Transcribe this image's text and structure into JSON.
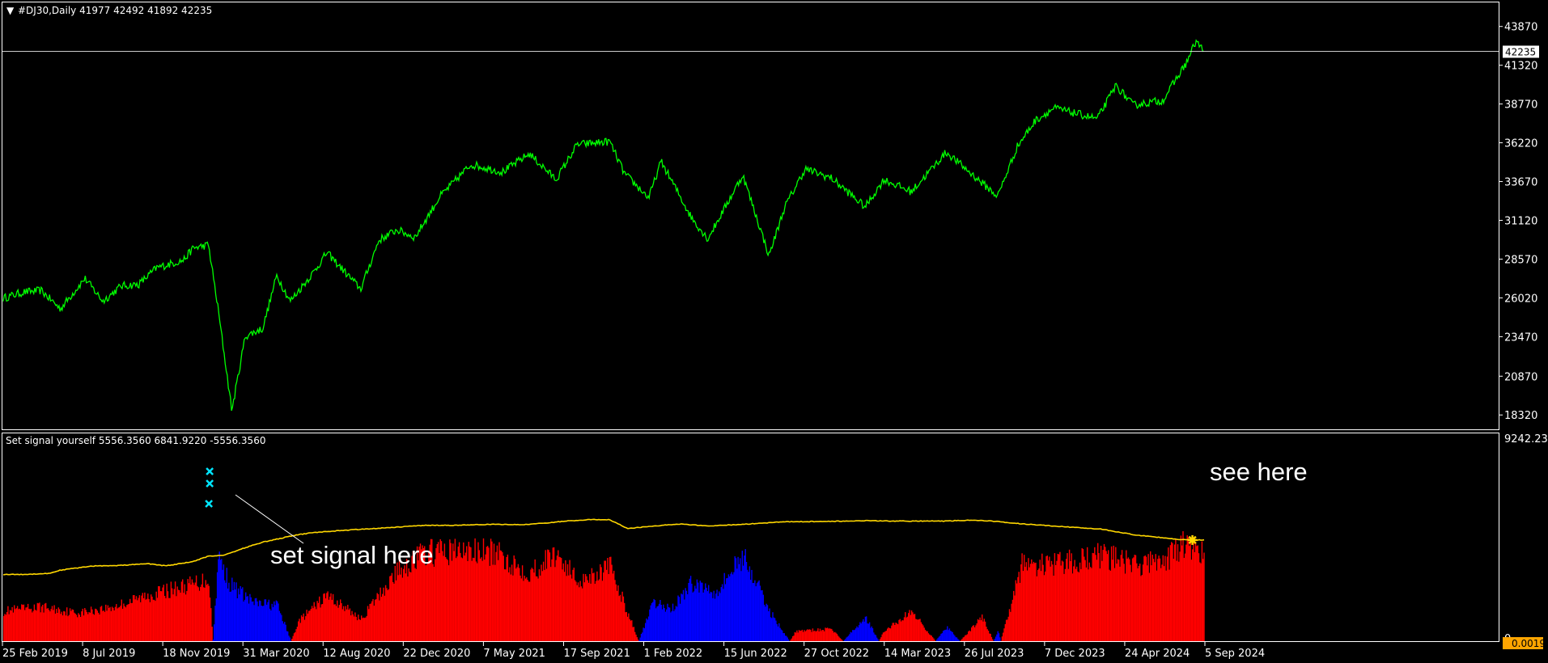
{
  "colors": {
    "background": "#000000",
    "grid_border": "#ffffff",
    "price_line": "#00ff00",
    "ma_line": "#ffd700",
    "hist_positive": "#ff0000",
    "hist_negative": "#0000ff",
    "signal_marker": "#00e5ff",
    "label_box": "#ffa500"
  },
  "main_panel": {
    "symbol_arrow": "▼",
    "title": "#DJ30,Daily  41977 42492 41892 42235",
    "current_price": "42235",
    "y_ticks": [
      "43870",
      "41320",
      "38770",
      "36220",
      "33670",
      "31120",
      "28570",
      "26020",
      "23470",
      "20870",
      "18320"
    ]
  },
  "sub_panel": {
    "title": "Set signal yourself 5556.3560 6841.9220 -5556.3560",
    "y_top": "9242.230",
    "y_zero": "0",
    "y_bottom_tag": "0.0019",
    "annotation_left": "set signal here",
    "annotation_right": "see here"
  },
  "x_ticks": [
    "25 Feb 2019",
    "8 Jul 2019",
    "18 Nov 2019",
    "31 Mar 2020",
    "12 Aug 2020",
    "22 Dec 2020",
    "7 May 2021",
    "17 Sep 2021",
    "1 Feb 2022",
    "15 Jun 2022",
    "27 Oct 2022",
    "14 Mar 2023",
    "26 Jul 2023",
    "7 Dec 2023",
    "24 Apr 2024",
    "5 Sep 2024"
  ],
  "chart_data": [
    {
      "type": "line",
      "title": "#DJ30,Daily  41977 42492 41892 42235",
      "x_range": [
        "2019-02-25",
        "2024-10-15"
      ],
      "ylim": [
        17800,
        44600
      ],
      "y_ticks": [
        43870,
        41320,
        38770,
        36220,
        33670,
        31120,
        28570,
        26020,
        23470,
        20870,
        18320
      ],
      "current_price": 42235,
      "series": [
        {
          "x": [
            "2019-02-25",
            "2019-04-01",
            "2019-05-01",
            "2019-06-03",
            "2019-07-15",
            "2019-08-15",
            "2019-09-15",
            "2019-10-15",
            "2019-11-15",
            "2019-12-31",
            "2020-01-17",
            "2020-02-12",
            "2020-02-28",
            "2020-03-23",
            "2020-04-15",
            "2020-05-15",
            "2020-06-08",
            "2020-07-01",
            "2020-08-12",
            "2020-09-02",
            "2020-10-30",
            "2020-11-30",
            "2020-12-31",
            "2021-01-31",
            "2021-03-15",
            "2021-05-07",
            "2021-06-30",
            "2021-08-15",
            "2021-09-30",
            "2021-11-05",
            "2021-12-31",
            "2022-01-25",
            "2022-03-08",
            "2022-03-29",
            "2022-05-20",
            "2022-06-17",
            "2022-08-16",
            "2022-09-30",
            "2022-10-27",
            "2022-12-01",
            "2023-01-15",
            "2023-03-14",
            "2023-04-15",
            "2023-06-01",
            "2023-07-31",
            "2023-10-27",
            "2023-11-30",
            "2023-12-31",
            "2024-02-01",
            "2024-04-15",
            "2024-05-17",
            "2024-06-15",
            "2024-08-05",
            "2024-09-15",
            "2024-10-01",
            "2024-10-15"
          ],
          "y": [
            26000,
            26400,
            26500,
            25300,
            27300,
            25800,
            26800,
            26900,
            28000,
            28500,
            29300,
            29500,
            25400,
            18600,
            23500,
            24000,
            27500,
            25800,
            27800,
            29000,
            26600,
            29800,
            30500,
            30000,
            32700,
            34800,
            34300,
            35500,
            33800,
            36100,
            36300,
            34200,
            32600,
            35000,
            31300,
            29900,
            34100,
            28800,
            32000,
            34500,
            33900,
            32000,
            33800,
            33000,
            35600,
            32700,
            36000,
            37700,
            38500,
            37800,
            40000,
            38700,
            39000,
            41500,
            42900,
            42235
          ]
        }
      ]
    },
    {
      "type": "bar",
      "title": "Set signal yourself 5556.3560 6841.9220 -5556.3560",
      "x_range": [
        "2019-02-25",
        "2024-10-15"
      ],
      "ylim": [
        0,
        9242.23
      ],
      "histogram_positive_color": "red",
      "histogram_negative_color": "blue",
      "series": [
        {
          "type": "area",
          "x": [
            "2019-02-25",
            "2019-04-01",
            "2019-05-15",
            "2019-06-03",
            "2019-07-01",
            "2019-08-01",
            "2019-09-01",
            "2019-10-01",
            "2019-11-01",
            "2019-12-01",
            "2020-01-17",
            "2020-02-12",
            "2020-03-10",
            "2020-04-10",
            "2020-05-15",
            "2020-06-15",
            "2020-07-15",
            "2020-08-12",
            "2020-09-30",
            "2020-10-30",
            "2020-11-30",
            "2020-12-31",
            "2021-02-15",
            "2021-04-01",
            "2021-05-07",
            "2021-06-15",
            "2021-08-01",
            "2021-09-17",
            "2021-10-15",
            "2021-11-30",
            "2021-12-31",
            "2022-01-10",
            "2022-02-01",
            "2022-03-15",
            "2022-05-01",
            "2022-06-15",
            "2022-08-16",
            "2022-10-27",
            "2022-12-31",
            "2023-03-14",
            "2023-05-01",
            "2023-07-26",
            "2023-09-15",
            "2023-10-31",
            "2023-12-07",
            "2024-02-01",
            "2024-04-24",
            "2024-06-15",
            "2024-09-05",
            "2024-10-15"
          ],
          "y": [
            3100,
            3100,
            3150,
            3300,
            3400,
            3500,
            3500,
            3550,
            3600,
            3500,
            3700,
            3950,
            4000,
            4300,
            4600,
            4780,
            4950,
            5050,
            5150,
            5200,
            5250,
            5300,
            5380,
            5380,
            5400,
            5430,
            5410,
            5500,
            5580,
            5650,
            5650,
            5500,
            5230,
            5350,
            5450,
            5350,
            5430,
            5550,
            5560,
            5600,
            5580,
            5580,
            5630,
            5550,
            5450,
            5350,
            5200,
            4950,
            4720,
            4700
          ]
        },
        {
          "type": "histogram",
          "x": [
            "2019-02-25",
            "2019-05-01",
            "2019-07-01",
            "2019-09-01",
            "2019-11-01",
            "2020-01-10",
            "2020-02-12",
            "2020-02-28",
            "2020-03-20",
            "2020-04-30",
            "2020-06-08",
            "2020-07-15",
            "2020-09-02",
            "2020-10-30",
            "2020-12-31",
            "2021-02-15",
            "2021-04-15",
            "2021-06-15",
            "2021-08-15",
            "2021-09-30",
            "2021-11-05",
            "2021-12-31",
            "2022-01-25",
            "2022-03-15",
            "2022-04-15",
            "2022-05-20",
            "2022-07-01",
            "2022-08-16",
            "2022-09-30",
            "2022-11-15",
            "2023-01-15",
            "2023-03-14",
            "2023-04-15",
            "2023-06-01",
            "2023-07-31",
            "2023-09-30",
            "2023-10-27",
            "2023-12-07",
            "2024-02-01",
            "2024-04-24",
            "2024-06-15",
            "2024-08-05",
            "2024-09-15",
            "2024-10-15"
          ],
          "y": [
            1500,
            1700,
            1400,
            1700,
            2300,
            2800,
            3100,
            -4200,
            -2800,
            -1900,
            -1800,
            1000,
            2300,
            1100,
            3500,
            4400,
            4500,
            4400,
            3400,
            4400,
            3000,
            3700,
            1800,
            -1900,
            -1600,
            -2900,
            -2500,
            -4300,
            -1500,
            500,
            600,
            -1200,
            500,
            1500,
            -700,
            1200,
            -500,
            3800,
            3800,
            4300,
            3800,
            4000,
            4900,
            4200
          ]
        }
      ]
    }
  ]
}
